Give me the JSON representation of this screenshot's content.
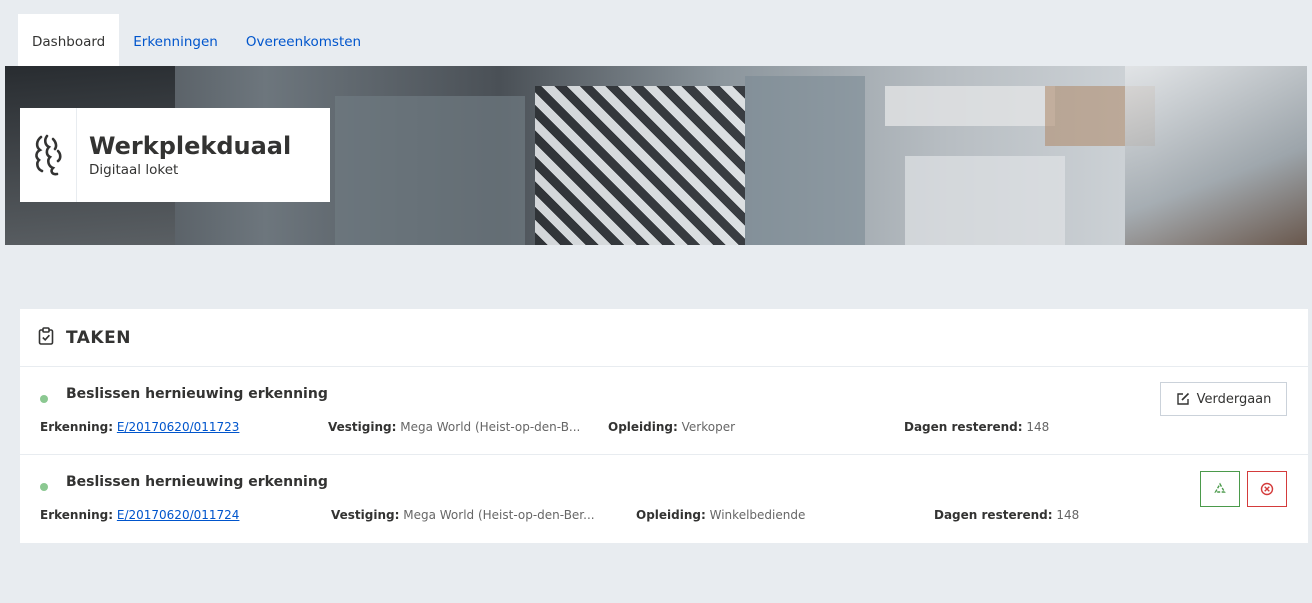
{
  "tabs": [
    {
      "label": "Dashboard",
      "active": true
    },
    {
      "label": "Erkenningen",
      "active": false
    },
    {
      "label": "Overeenkomsten",
      "active": false
    }
  ],
  "brand": {
    "title": "Werkplekduaal",
    "subtitle": "Digitaal loket"
  },
  "taken": {
    "header": "TAKEN",
    "items": [
      {
        "title": "Beslissen hernieuwing erkenning",
        "erkenning_label": "Erkenning:",
        "erkenning_value": "E/20170620/011723",
        "vestiging_label": "Vestiging:",
        "vestiging_value": "Mega World (Heist-op-den-B...",
        "opleiding_label": "Opleiding:",
        "opleiding_value": "Verkoper",
        "dagen_label": "Dagen resterend:",
        "dagen_value": "148",
        "action_label": "Verdergaan"
      },
      {
        "title": "Beslissen hernieuwing erkenning",
        "erkenning_label": "Erkenning:",
        "erkenning_value": "E/20170620/011724",
        "vestiging_label": "Vestiging:",
        "vestiging_value": "Mega World (Heist-op-den-Ber...",
        "opleiding_label": "Opleiding:",
        "opleiding_value": "Winkelbediende",
        "dagen_label": "Dagen resterend:",
        "dagen_value": "148"
      }
    ]
  },
  "colors": {
    "link": "#0055cc",
    "status_dot": "#8bc891",
    "approve": "#4b9a4b",
    "reject": "#d43b3b",
    "background": "#e8ecf0"
  }
}
